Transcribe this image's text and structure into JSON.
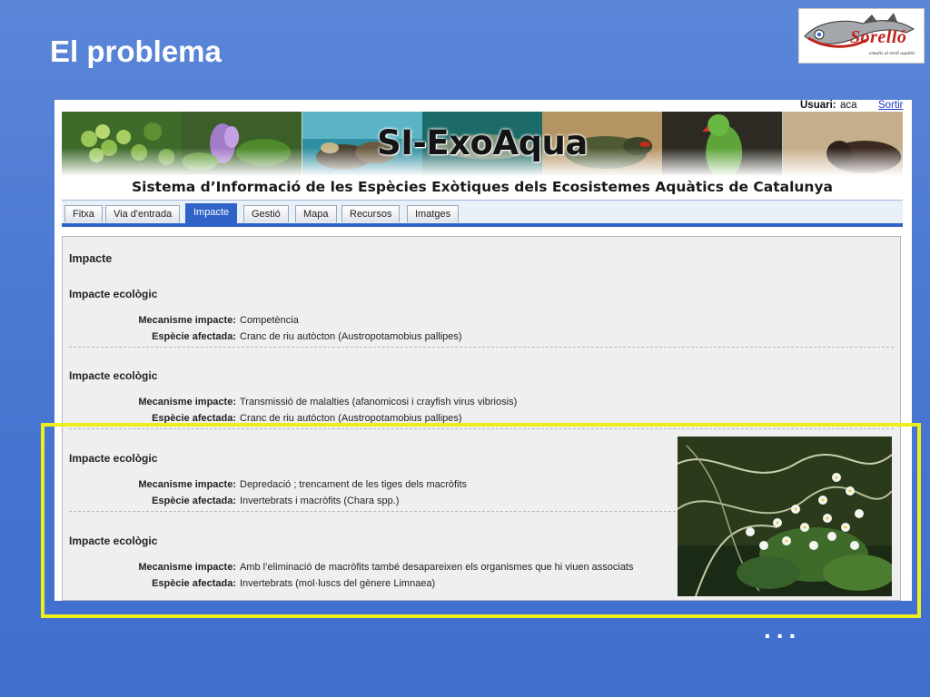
{
  "slide": {
    "title": "El problema",
    "continuation": "...",
    "logo": {
      "word": "Sorelló",
      "tagline": "estudis al medi aquàtic"
    }
  },
  "app": {
    "user_label": "Usuari:",
    "user_value": "aca",
    "logout_label": "Sortir",
    "banner_title": "SI-ExoAqua",
    "banner_subtitle": "Sistema d’Informació  de les Espècies Exòtiques dels Ecosistemes Aquàtics de Catalunya",
    "banner_photos": [
      "aquatic-plant-grapes",
      "water-hyacinth-flower",
      "zebra-mussels",
      "fish-arapaima",
      "red-eared-slider-turtle",
      "parakeet",
      "american-mink"
    ],
    "tabs": [
      {
        "label": "Fitxa",
        "active": false
      },
      {
        "label": "Via d'entrada",
        "active": false
      },
      {
        "label": "Impacte",
        "active": true
      },
      {
        "label": "Gestió",
        "active": false
      },
      {
        "label": "Mapa",
        "active": false
      },
      {
        "label": "Recursos",
        "active": false
      },
      {
        "label": "Imatges",
        "active": false
      }
    ],
    "panel": {
      "heading": "Impacte",
      "sections": [
        {
          "heading": "Impacte ecològic",
          "mechanism_label": "Mecanisme impacte:",
          "mechanism": "Competència",
          "species_label": "Espècie afectada:",
          "species": "Cranc de riu autòcton (Austropotamobius pallipes)"
        },
        {
          "heading": "Impacte ecològic",
          "mechanism_label": "Mecanisme impacte:",
          "mechanism": "Transmissió de malalties (afanomicosi i crayfish virus vibriosis)",
          "species_label": "Espècie afectada:",
          "species": "Cranc de riu autòcton (Austropotamobius pallipes)"
        },
        {
          "heading": "Impacte ecològic",
          "mechanism_label": "Mecanisme impacte:",
          "mechanism": "Depredació ; trencament de les tiges dels macròfits",
          "species_label": "Espècie afectada:",
          "species": "Invertebrats i macròfits (Chara spp.)"
        },
        {
          "heading": "Impacte ecològic",
          "mechanism_label": "Mecanisme impacte:",
          "mechanism": "Amb l’eliminació de macròfits també desapareixen els organismes que hi viuen associats",
          "species_label": "Espècie afectada:",
          "species": "Invertebrats (mol·luscs del gènere Limnaea)"
        }
      ],
      "inset_photo": "water-crowfoot-flowers"
    }
  },
  "colors": {
    "slide_bg": "#4a78d2",
    "highlight": "#eeee1c",
    "tab_active": "#2f63c8",
    "panel_bg": "#efefef"
  }
}
